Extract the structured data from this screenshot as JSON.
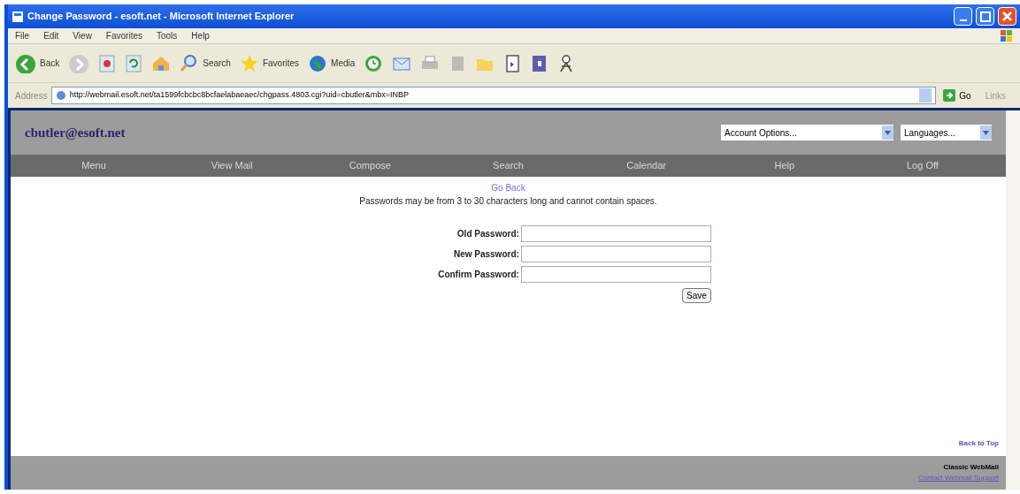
{
  "window": {
    "title": "Change Password - esoft.net - Microsoft Internet Explorer"
  },
  "menu_bar": [
    "File",
    "Edit",
    "View",
    "Favorites",
    "Tools",
    "Help"
  ],
  "toolbar": [
    {
      "kind": "back",
      "label": "Back"
    },
    {
      "kind": "forward"
    },
    {
      "kind": "stop"
    },
    {
      "kind": "refresh"
    },
    {
      "kind": "home"
    },
    {
      "kind": "search",
      "label": "Search"
    },
    {
      "kind": "favorites",
      "label": "Favorites"
    },
    {
      "kind": "media",
      "label": "Media"
    },
    {
      "kind": "history"
    },
    {
      "kind": "mail"
    },
    {
      "kind": "print"
    },
    {
      "kind": "edit"
    },
    {
      "kind": "folder"
    },
    {
      "kind": "page"
    },
    {
      "kind": "book"
    },
    {
      "kind": "messenger"
    }
  ],
  "address_bar": {
    "label": "Address",
    "url": "http://webmail.esoft.net/ta1599fcbcbc8bcfaelabaeaec/chgpass.4803.cgi?uid=cbutler&mbx=INBP",
    "go": "Go",
    "links": "Links"
  },
  "header": {
    "account": "cbutler@esoft.net",
    "account_options": "Account Options...",
    "languages": "Languages..."
  },
  "nav": [
    "Menu",
    "View Mail",
    "Compose",
    "Search",
    "Calendar",
    "Help",
    "Log Off"
  ],
  "body": {
    "go_back": "Go Back",
    "hint": "Passwords may be from 3 to 30 characters long and cannot contain spaces.",
    "fields": [
      {
        "label": "Old Password:"
      },
      {
        "label": "New Password:"
      },
      {
        "label": "Confirm Password:"
      }
    ],
    "save": "Save",
    "back_to_top": "Back to Top"
  },
  "footer": {
    "product": "Classic WebMail",
    "support": "Contact Webmail Support"
  }
}
